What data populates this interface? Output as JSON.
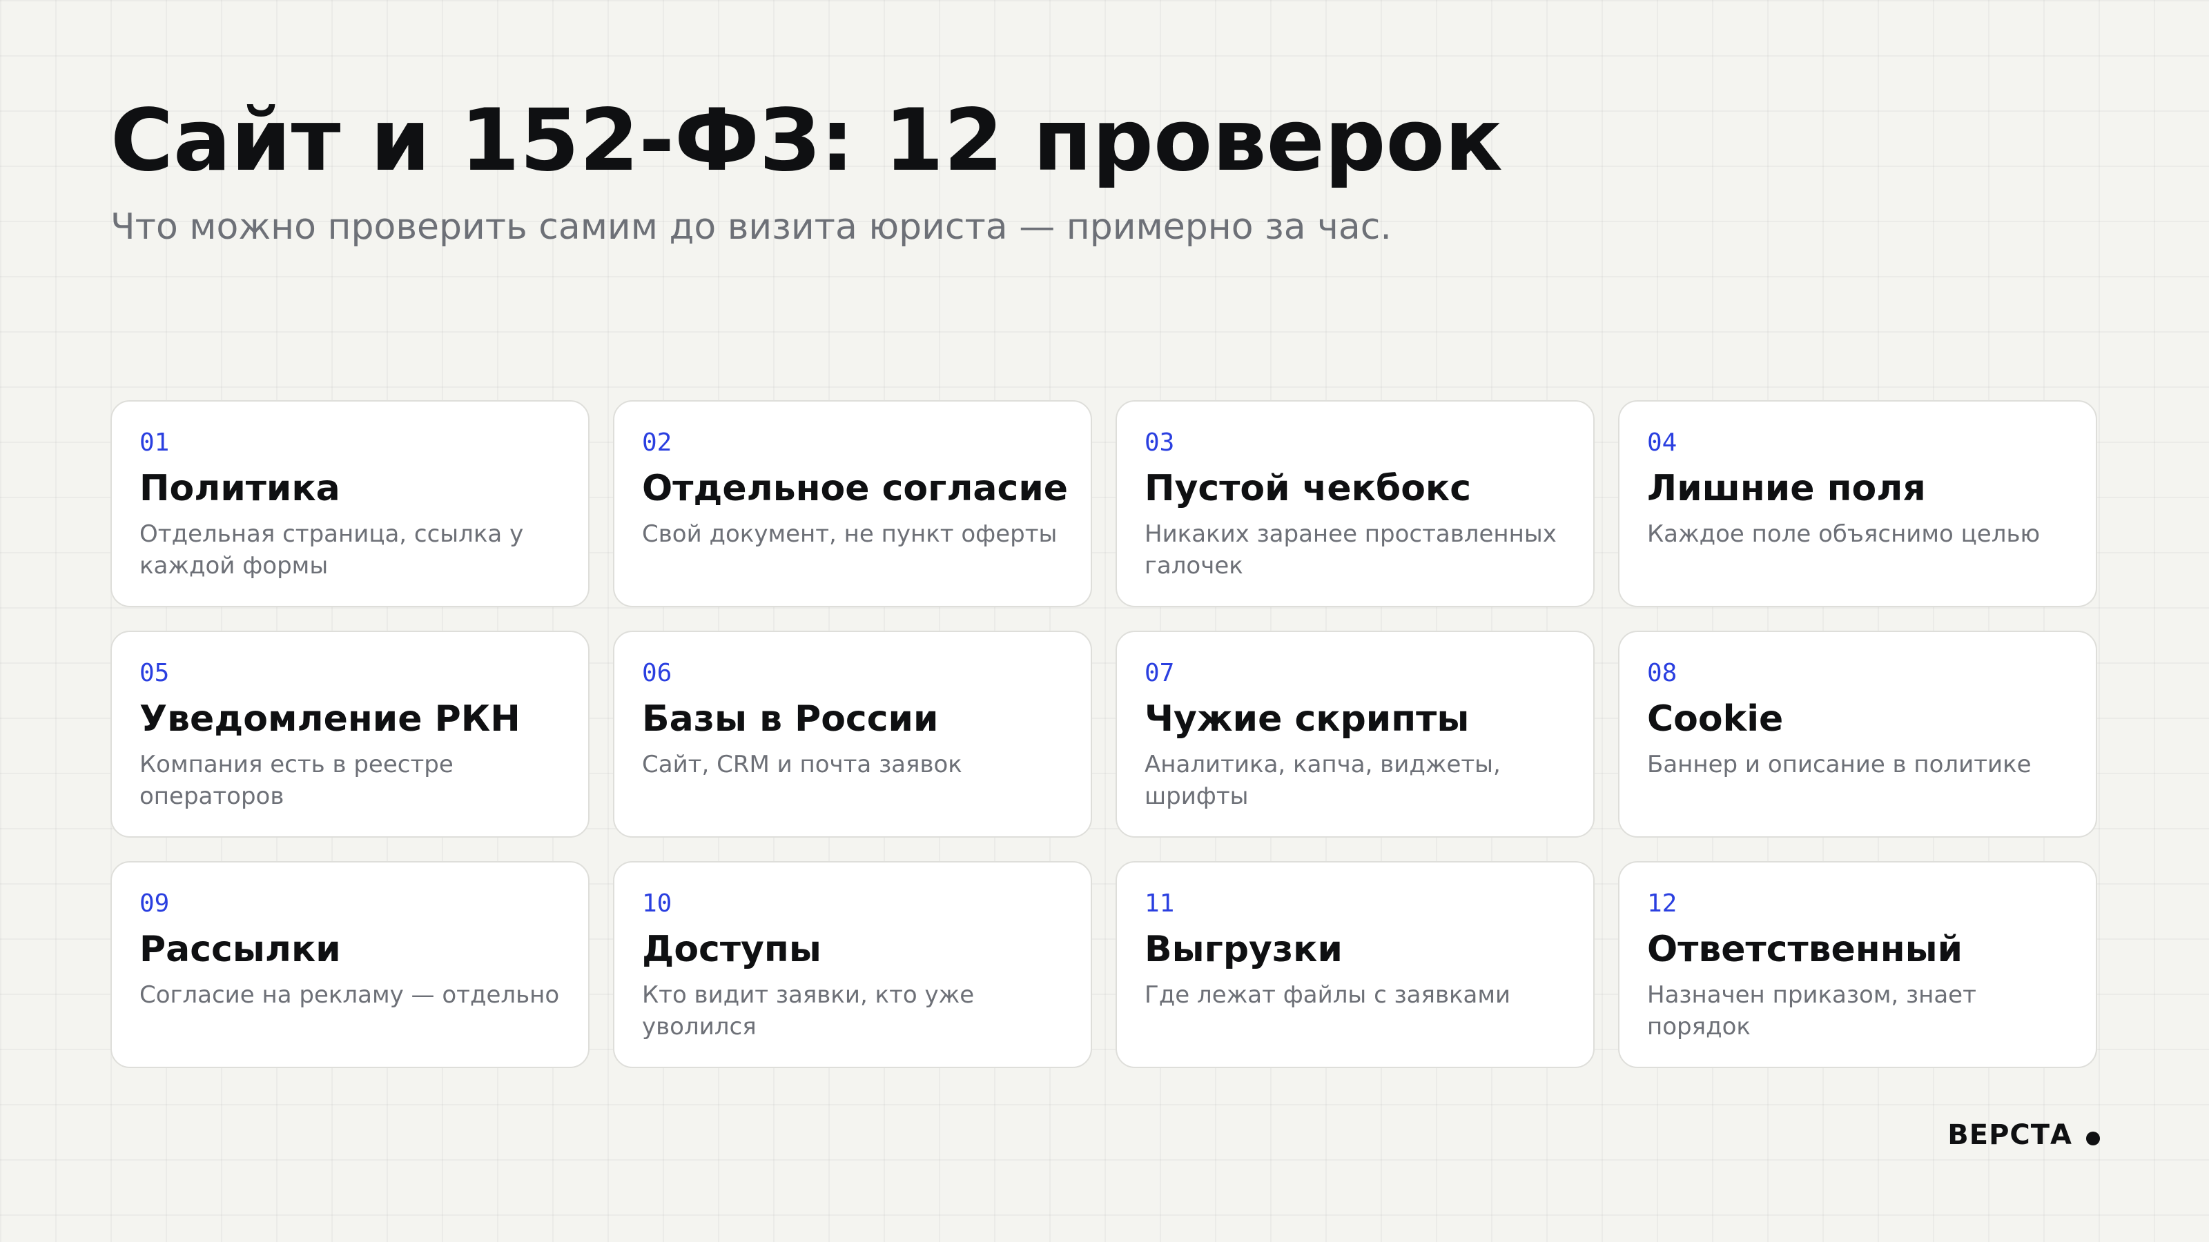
{
  "header": {
    "title": "Сайт и 152-ФЗ: 12 проверок",
    "subtitle": "Что можно проверить самим до визита юриста — примерно за час."
  },
  "cards": [
    {
      "num": "01",
      "title": "Политика",
      "desc": "Отдельная страница, ссылка у каждой формы"
    },
    {
      "num": "02",
      "title": "Отдельное согласие",
      "desc": "Свой документ, не пункт оферты"
    },
    {
      "num": "03",
      "title": "Пустой чекбокс",
      "desc": "Никаких заранее проставленных галочек"
    },
    {
      "num": "04",
      "title": "Лишние поля",
      "desc": "Каждое поле объяснимо целью"
    },
    {
      "num": "05",
      "title": "Уведомление РКН",
      "desc": "Компания есть в реестре операторов"
    },
    {
      "num": "06",
      "title": "Базы в России",
      "desc": "Сайт, CRM и почта заявок"
    },
    {
      "num": "07",
      "title": "Чужие скрипты",
      "desc": "Аналитика, капча, виджеты, шрифты"
    },
    {
      "num": "08",
      "title": "Cookie",
      "desc": "Баннер и описание в политике"
    },
    {
      "num": "09",
      "title": "Рассылки",
      "desc": "Согласие на рекламу — отдельно"
    },
    {
      "num": "10",
      "title": "Доступы",
      "desc": "Кто видит заявки, кто уже уволился"
    },
    {
      "num": "11",
      "title": "Выгрузки",
      "desc": "Где лежат файлы с заявками"
    },
    {
      "num": "12",
      "title": "Ответственный",
      "desc": "Назначен приказом, знает порядок"
    }
  ],
  "footer": {
    "brand": "ВЕРСТА"
  },
  "colors": {
    "background": "#f4f4f0",
    "accent": "#2a3fe0",
    "text": "#0f1012",
    "muted": "#6d7077",
    "card": "#ffffff"
  }
}
